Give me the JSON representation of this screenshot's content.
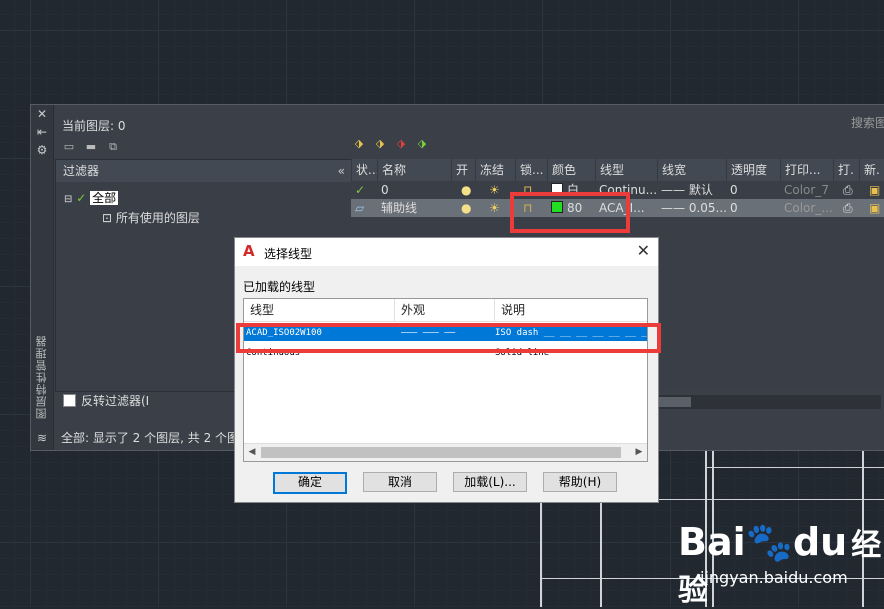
{
  "palette": {
    "current_layer_label": "当前图层: 0",
    "search_label": "搜索图",
    "side_title": "图层特性管理器",
    "filter_header": "过滤器",
    "tree_all": "全部",
    "tree_used": "所有使用的图层",
    "invert_filter": "反转过滤器(I",
    "status_text": "全部: 显示了 2 个图层, 共 2 个图"
  },
  "layer_table": {
    "columns": [
      "状...",
      "名称",
      "开",
      "冻结",
      "锁...",
      "颜色",
      "线型",
      "线宽",
      "透明度",
      "打印...",
      "打.",
      "新."
    ],
    "rows": [
      {
        "name": "0",
        "color_name": "白",
        "color_hex": "#ffffff",
        "linetype": "Continu...",
        "lineweight": "—— 默认",
        "transparency": "0",
        "plot_style": "Color_7"
      },
      {
        "name": "辅助线",
        "color_name": "80",
        "color_hex": "#22dd22",
        "linetype": "ACA_I...",
        "lineweight": "—— 0.05...",
        "transparency": "0",
        "plot_style": "Color_..."
      }
    ]
  },
  "dialog": {
    "title": "选择线型",
    "loaded_label": "已加载的线型",
    "columns": [
      "线型",
      "外观",
      "说明"
    ],
    "rows": [
      {
        "linetype": "ACAD_ISO02W100",
        "appearance": "——— ——— ——",
        "description": "ISO dash __ __ __ __ __ __ _"
      },
      {
        "linetype": "Continuous",
        "appearance": "——————————",
        "description": "Solid line"
      }
    ],
    "ok": "确定",
    "cancel": "取消",
    "load": "加载(L)...",
    "help": "帮助(H)"
  },
  "watermark": {
    "brand_a": "Bai",
    "brand_b": "du",
    "brand_c": "经验",
    "url": "jingyan.baidu.com"
  },
  "colors": {
    "highlight_red": "#ec3b3b",
    "selection_blue": "#0078d7"
  }
}
